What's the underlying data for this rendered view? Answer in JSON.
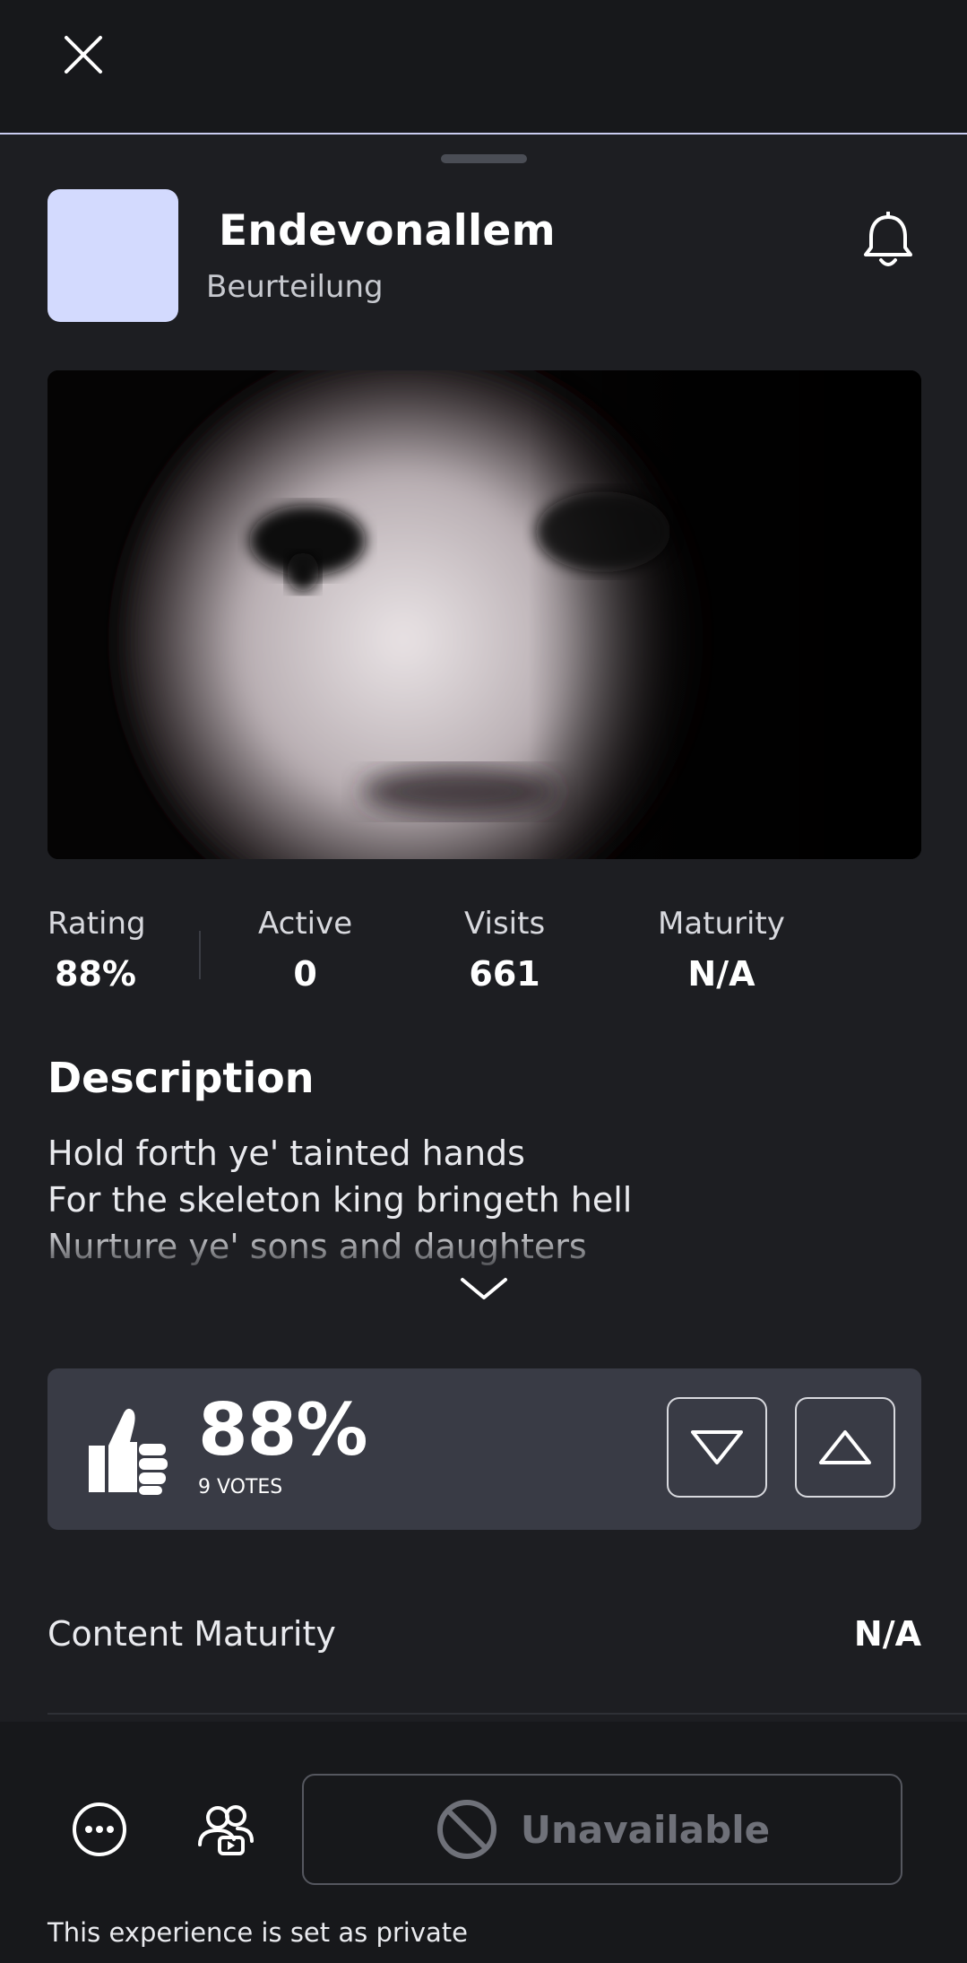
{
  "game": {
    "title": "Endevonallem",
    "creator": "Beurteilung",
    "icon_color": "#d3dafe"
  },
  "stats": [
    {
      "label": "Rating",
      "value": "88%"
    },
    {
      "label": "Active",
      "value": "0"
    },
    {
      "label": "Visits",
      "value": "661"
    },
    {
      "label": "Maturity",
      "value": "N/A"
    }
  ],
  "description": {
    "heading": "Description",
    "text": "Hold forth ye' tainted hands\nFor the skeleton king bringeth hell\nNurture ye' sons and daughters"
  },
  "votes": {
    "percent": "88%",
    "count_label": "9 VOTES"
  },
  "content_maturity": {
    "label": "Content Maturity",
    "value": "N/A"
  },
  "actions": {
    "play_label": "Unavailable",
    "private_note": "This experience is set as private"
  },
  "icons": [
    "close-icon",
    "bell-icon",
    "chevron-down-icon",
    "thumbs-up-icon",
    "thumbs-down-triangle-icon",
    "thumbs-up-triangle-icon",
    "more-icon",
    "party-icon",
    "prohibited-icon"
  ],
  "colors": {
    "background": "#1d1e22",
    "topbar": "#17181b",
    "accent_line": "#c9ccf0",
    "vote_panel": "#393b45",
    "disabled_text": "#6f7179"
  }
}
